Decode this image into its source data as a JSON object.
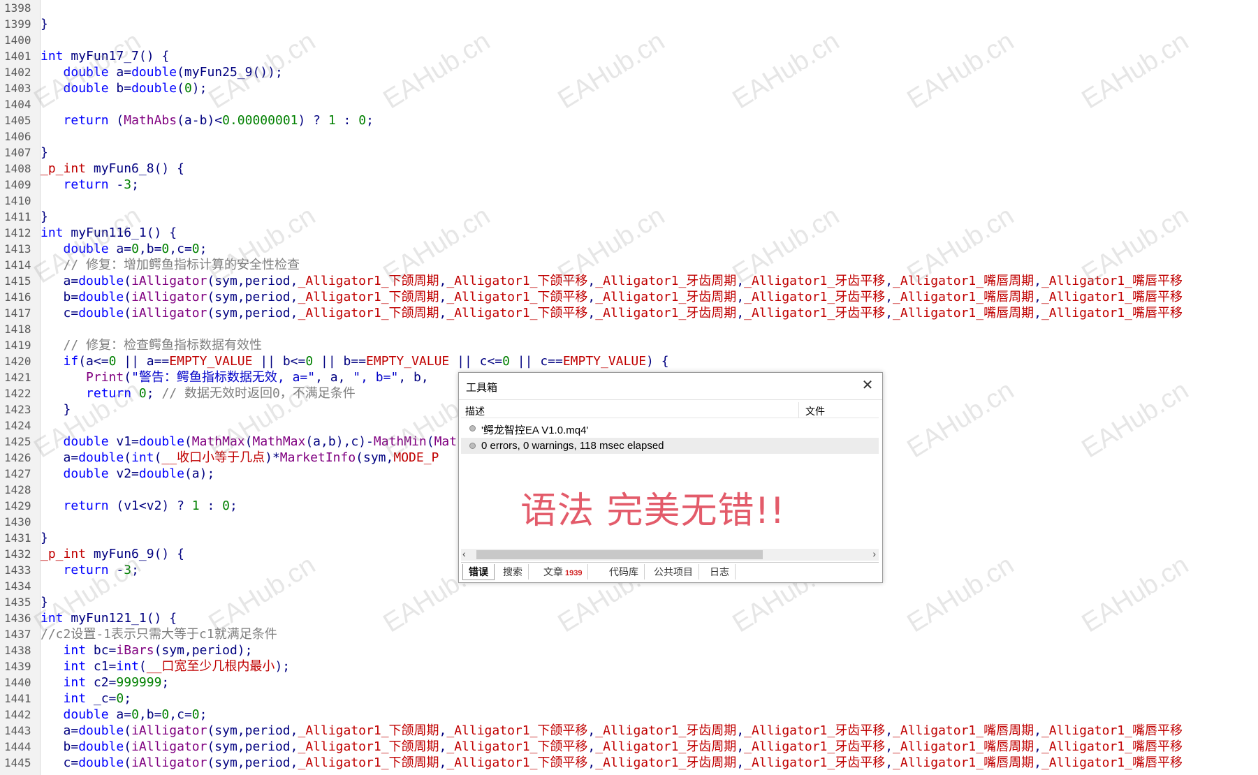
{
  "editor": {
    "lines": [
      {
        "n": "1398",
        "t": []
      },
      {
        "n": "1399",
        "t": [
          [
            "}",
            "p"
          ]
        ]
      },
      {
        "n": "1400",
        "t": []
      },
      {
        "n": "1401",
        "t": [
          [
            "int",
            "typ"
          ],
          [
            " myFun17_7() {",
            "p"
          ]
        ]
      },
      {
        "n": "1402",
        "t": [
          [
            "   ",
            "p"
          ],
          [
            "double",
            "typ"
          ],
          [
            " a=",
            "p"
          ],
          [
            "double",
            "typ"
          ],
          [
            "(myFun25_9());",
            "p"
          ]
        ]
      },
      {
        "n": "1403",
        "t": [
          [
            "   ",
            "p"
          ],
          [
            "double",
            "typ"
          ],
          [
            " b=",
            "p"
          ],
          [
            "double",
            "typ"
          ],
          [
            "(",
            "p"
          ],
          [
            "0",
            "num"
          ],
          [
            ");",
            "p"
          ]
        ]
      },
      {
        "n": "1404",
        "t": []
      },
      {
        "n": "1405",
        "t": [
          [
            "   ",
            "p"
          ],
          [
            "return",
            "kw"
          ],
          [
            " (",
            "p"
          ],
          [
            "MathAbs",
            "fn"
          ],
          [
            "(a-b)<",
            "p"
          ],
          [
            "0.00000001",
            "num"
          ],
          [
            ") ? ",
            "p"
          ],
          [
            "1",
            "num"
          ],
          [
            " : ",
            "p"
          ],
          [
            "0",
            "num"
          ],
          [
            ";",
            "p"
          ]
        ]
      },
      {
        "n": "1406",
        "t": []
      },
      {
        "n": "1407",
        "t": [
          [
            "}",
            "p"
          ]
        ]
      },
      {
        "n": "1408",
        "t": [
          [
            "_p_int",
            "mac"
          ],
          [
            " myFun6_8() {",
            "p"
          ]
        ]
      },
      {
        "n": "1409",
        "t": [
          [
            "   ",
            "p"
          ],
          [
            "return",
            "kw"
          ],
          [
            " -",
            "p"
          ],
          [
            "3",
            "num"
          ],
          [
            ";",
            "p"
          ]
        ]
      },
      {
        "n": "1410",
        "t": []
      },
      {
        "n": "1411",
        "t": [
          [
            "}",
            "p"
          ]
        ]
      },
      {
        "n": "1412",
        "t": [
          [
            "int",
            "typ"
          ],
          [
            " myFun116_1() {",
            "p"
          ]
        ]
      },
      {
        "n": "1413",
        "t": [
          [
            "   ",
            "p"
          ],
          [
            "double",
            "typ"
          ],
          [
            " a=",
            "p"
          ],
          [
            "0",
            "num"
          ],
          [
            ",b=",
            "p"
          ],
          [
            "0",
            "num"
          ],
          [
            ",c=",
            "p"
          ],
          [
            "0",
            "num"
          ],
          [
            ";",
            "p"
          ]
        ]
      },
      {
        "n": "1414",
        "t": [
          [
            "   // 修复：增加鳄鱼指标计算的安全性检查",
            "cmt"
          ]
        ]
      },
      {
        "n": "1415",
        "t": [
          [
            "   a=",
            "p"
          ],
          [
            "double",
            "typ"
          ],
          [
            "(",
            "p"
          ],
          [
            "iAlligator",
            "fn"
          ],
          [
            "(sym,period,",
            "p"
          ],
          [
            "_Alligator1_下颌周期",
            "cst"
          ],
          [
            ",",
            "p"
          ],
          [
            "_Alligator1_下颌平移",
            "cst"
          ],
          [
            ",",
            "p"
          ],
          [
            "_Alligator1_牙齿周期",
            "cst"
          ],
          [
            ",",
            "p"
          ],
          [
            "_Alligator1_牙齿平移",
            "cst"
          ],
          [
            ",",
            "p"
          ],
          [
            "_Alligator1_嘴唇周期",
            "cst"
          ],
          [
            ",",
            "p"
          ],
          [
            "_Alligator1_嘴唇平移",
            "cst"
          ]
        ]
      },
      {
        "n": "1416",
        "t": [
          [
            "   b=",
            "p"
          ],
          [
            "double",
            "typ"
          ],
          [
            "(",
            "p"
          ],
          [
            "iAlligator",
            "fn"
          ],
          [
            "(sym,period,",
            "p"
          ],
          [
            "_Alligator1_下颌周期",
            "cst"
          ],
          [
            ",",
            "p"
          ],
          [
            "_Alligator1_下颌平移",
            "cst"
          ],
          [
            ",",
            "p"
          ],
          [
            "_Alligator1_牙齿周期",
            "cst"
          ],
          [
            ",",
            "p"
          ],
          [
            "_Alligator1_牙齿平移",
            "cst"
          ],
          [
            ",",
            "p"
          ],
          [
            "_Alligator1_嘴唇周期",
            "cst"
          ],
          [
            ",",
            "p"
          ],
          [
            "_Alligator1_嘴唇平移",
            "cst"
          ]
        ]
      },
      {
        "n": "1417",
        "t": [
          [
            "   c=",
            "p"
          ],
          [
            "double",
            "typ"
          ],
          [
            "(",
            "p"
          ],
          [
            "iAlligator",
            "fn"
          ],
          [
            "(sym,period,",
            "p"
          ],
          [
            "_Alligator1_下颌周期",
            "cst"
          ],
          [
            ",",
            "p"
          ],
          [
            "_Alligator1_下颌平移",
            "cst"
          ],
          [
            ",",
            "p"
          ],
          [
            "_Alligator1_牙齿周期",
            "cst"
          ],
          [
            ",",
            "p"
          ],
          [
            "_Alligator1_牙齿平移",
            "cst"
          ],
          [
            ",",
            "p"
          ],
          [
            "_Alligator1_嘴唇周期",
            "cst"
          ],
          [
            ",",
            "p"
          ],
          [
            "_Alligator1_嘴唇平移",
            "cst"
          ]
        ]
      },
      {
        "n": "1418",
        "t": []
      },
      {
        "n": "1419",
        "t": [
          [
            "   // 修复：检查鳄鱼指标数据有效性",
            "cmt"
          ]
        ]
      },
      {
        "n": "1420",
        "t": [
          [
            "   ",
            "p"
          ],
          [
            "if",
            "kw"
          ],
          [
            "(a<=",
            "p"
          ],
          [
            "0",
            "num"
          ],
          [
            " || a==",
            "p"
          ],
          [
            "EMPTY_VALUE",
            "cst"
          ],
          [
            " || b<=",
            "p"
          ],
          [
            "0",
            "num"
          ],
          [
            " || b==",
            "p"
          ],
          [
            "EMPTY_VALUE",
            "cst"
          ],
          [
            " || c<=",
            "p"
          ],
          [
            "0",
            "num"
          ],
          [
            " || c==",
            "p"
          ],
          [
            "EMPTY_VALUE",
            "cst"
          ],
          [
            ") {",
            "p"
          ]
        ]
      },
      {
        "n": "1421",
        "t": [
          [
            "      ",
            "p"
          ],
          [
            "Print",
            "fn"
          ],
          [
            "(",
            "p"
          ],
          [
            "\"警告：鳄鱼指标数据无效, a=\"",
            "str"
          ],
          [
            ", a, ",
            "p"
          ],
          [
            "\", b=\"",
            "str"
          ],
          [
            ", b, ",
            "p"
          ]
        ]
      },
      {
        "n": "1422",
        "t": [
          [
            "      ",
            "p"
          ],
          [
            "return",
            "kw"
          ],
          [
            " ",
            "p"
          ],
          [
            "0",
            "num"
          ],
          [
            "; ",
            "p"
          ],
          [
            "// 数据无效时返回0，不满足条件",
            "cmt"
          ]
        ]
      },
      {
        "n": "1423",
        "t": [
          [
            "   }",
            "p"
          ]
        ]
      },
      {
        "n": "1424",
        "t": []
      },
      {
        "n": "1425",
        "t": [
          [
            "   ",
            "p"
          ],
          [
            "double",
            "typ"
          ],
          [
            " v1=",
            "p"
          ],
          [
            "double",
            "typ"
          ],
          [
            "(",
            "p"
          ],
          [
            "MathMax",
            "fn"
          ],
          [
            "(",
            "p"
          ],
          [
            "MathMax",
            "fn"
          ],
          [
            "(a,b),c)-",
            "p"
          ],
          [
            "MathMin",
            "fn"
          ],
          [
            "(",
            "p"
          ],
          [
            "Mat",
            "fn"
          ]
        ]
      },
      {
        "n": "1426",
        "t": [
          [
            "   a=",
            "p"
          ],
          [
            "double",
            "typ"
          ],
          [
            "(",
            "p"
          ],
          [
            "int",
            "typ"
          ],
          [
            "(",
            "p"
          ],
          [
            "__收口小等于几点",
            "cst"
          ],
          [
            ")*",
            "p"
          ],
          [
            "MarketInfo",
            "fn"
          ],
          [
            "(sym,",
            "p"
          ],
          [
            "MODE_P",
            "cst"
          ]
        ]
      },
      {
        "n": "1427",
        "t": [
          [
            "   ",
            "p"
          ],
          [
            "double",
            "typ"
          ],
          [
            " v2=",
            "p"
          ],
          [
            "double",
            "typ"
          ],
          [
            "(a);",
            "p"
          ]
        ]
      },
      {
        "n": "1428",
        "t": []
      },
      {
        "n": "1429",
        "t": [
          [
            "   ",
            "p"
          ],
          [
            "return",
            "kw"
          ],
          [
            " (v1<v2) ? ",
            "p"
          ],
          [
            "1",
            "num"
          ],
          [
            " : ",
            "p"
          ],
          [
            "0",
            "num"
          ],
          [
            ";",
            "p"
          ]
        ]
      },
      {
        "n": "1430",
        "t": []
      },
      {
        "n": "1431",
        "t": [
          [
            "}",
            "p"
          ]
        ]
      },
      {
        "n": "1432",
        "t": [
          [
            "_p_int",
            "mac"
          ],
          [
            " myFun6_9() {",
            "p"
          ]
        ]
      },
      {
        "n": "1433",
        "t": [
          [
            "   ",
            "p"
          ],
          [
            "return",
            "kw"
          ],
          [
            " -",
            "p"
          ],
          [
            "3",
            "num"
          ],
          [
            ";",
            "p"
          ]
        ]
      },
      {
        "n": "1434",
        "t": []
      },
      {
        "n": "1435",
        "t": [
          [
            "}",
            "p"
          ]
        ]
      },
      {
        "n": "1436",
        "t": [
          [
            "int",
            "typ"
          ],
          [
            " myFun121_1() {",
            "p"
          ]
        ]
      },
      {
        "n": "1437",
        "t": [
          [
            "//c2设置-1表示只需大等于c1就满足条件",
            "cmt"
          ]
        ]
      },
      {
        "n": "1438",
        "t": [
          [
            "   ",
            "p"
          ],
          [
            "int",
            "typ"
          ],
          [
            " bc=",
            "p"
          ],
          [
            "iBars",
            "fn"
          ],
          [
            "(sym,period);",
            "p"
          ]
        ]
      },
      {
        "n": "1439",
        "t": [
          [
            "   ",
            "p"
          ],
          [
            "int",
            "typ"
          ],
          [
            " c1=",
            "p"
          ],
          [
            "int",
            "typ"
          ],
          [
            "(",
            "p"
          ],
          [
            "__口宽至少几根内最小",
            "cst"
          ],
          [
            ");",
            "p"
          ]
        ]
      },
      {
        "n": "1440",
        "t": [
          [
            "   ",
            "p"
          ],
          [
            "int",
            "typ"
          ],
          [
            " c2=",
            "p"
          ],
          [
            "999999",
            "num"
          ],
          [
            ";",
            "p"
          ]
        ]
      },
      {
        "n": "1441",
        "t": [
          [
            "   ",
            "p"
          ],
          [
            "int",
            "typ"
          ],
          [
            " _c=",
            "p"
          ],
          [
            "0",
            "num"
          ],
          [
            ";",
            "p"
          ]
        ]
      },
      {
        "n": "1442",
        "t": [
          [
            "   ",
            "p"
          ],
          [
            "double",
            "typ"
          ],
          [
            " a=",
            "p"
          ],
          [
            "0",
            "num"
          ],
          [
            ",b=",
            "p"
          ],
          [
            "0",
            "num"
          ],
          [
            ",c=",
            "p"
          ],
          [
            "0",
            "num"
          ],
          [
            ";",
            "p"
          ]
        ]
      },
      {
        "n": "1443",
        "t": [
          [
            "   a=",
            "p"
          ],
          [
            "double",
            "typ"
          ],
          [
            "(",
            "p"
          ],
          [
            "iAlligator",
            "fn"
          ],
          [
            "(sym,period,",
            "p"
          ],
          [
            "_Alligator1_下颌周期",
            "cst"
          ],
          [
            ",",
            "p"
          ],
          [
            "_Alligator1_下颌平移",
            "cst"
          ],
          [
            ",",
            "p"
          ],
          [
            "_Alligator1_牙齿周期",
            "cst"
          ],
          [
            ",",
            "p"
          ],
          [
            "_Alligator1_牙齿平移",
            "cst"
          ],
          [
            ",",
            "p"
          ],
          [
            "_Alligator1_嘴唇周期",
            "cst"
          ],
          [
            ",",
            "p"
          ],
          [
            "_Alligator1_嘴唇平移",
            "cst"
          ]
        ]
      },
      {
        "n": "1444",
        "t": [
          [
            "   b=",
            "p"
          ],
          [
            "double",
            "typ"
          ],
          [
            "(",
            "p"
          ],
          [
            "iAlligator",
            "fn"
          ],
          [
            "(sym,period,",
            "p"
          ],
          [
            "_Alligator1_下颌周期",
            "cst"
          ],
          [
            ",",
            "p"
          ],
          [
            "_Alligator1_下颌平移",
            "cst"
          ],
          [
            ",",
            "p"
          ],
          [
            "_Alligator1_牙齿周期",
            "cst"
          ],
          [
            ",",
            "p"
          ],
          [
            "_Alligator1_牙齿平移",
            "cst"
          ],
          [
            ",",
            "p"
          ],
          [
            "_Alligator1_嘴唇周期",
            "cst"
          ],
          [
            ",",
            "p"
          ],
          [
            "_Alligator1_嘴唇平移",
            "cst"
          ]
        ]
      },
      {
        "n": "1445",
        "t": [
          [
            "   c=",
            "p"
          ],
          [
            "double",
            "typ"
          ],
          [
            "(",
            "p"
          ],
          [
            "iAlligator",
            "fn"
          ],
          [
            "(sym,period,",
            "p"
          ],
          [
            "_Alligator1_下颌周期",
            "cst"
          ],
          [
            ",",
            "p"
          ],
          [
            "_Alligator1_下颌平移",
            "cst"
          ],
          [
            ",",
            "p"
          ],
          [
            "_Alligator1_牙齿周期",
            "cst"
          ],
          [
            ",",
            "p"
          ],
          [
            "_Alligator1_牙齿平移",
            "cst"
          ],
          [
            ",",
            "p"
          ],
          [
            "_Alligator1_嘴唇周期",
            "cst"
          ],
          [
            ",",
            "p"
          ],
          [
            "_Alligator1_嘴唇平移",
            "cst"
          ]
        ]
      }
    ]
  },
  "watermark": {
    "text": "EAHub.cn"
  },
  "toolbox": {
    "title": "工具箱",
    "close_glyph": "✕",
    "columns": {
      "description": "描述",
      "file": "文件"
    },
    "rows": [
      {
        "text": "'鳄龙智控EA V1.0.mq4'"
      },
      {
        "text": "0 errors, 0 warnings, 118 msec elapsed"
      }
    ],
    "big_message": "语法 完美无错!!",
    "scroll": {
      "left": "‹",
      "right": "›"
    },
    "tabs": [
      {
        "label": "错误",
        "active": true
      },
      {
        "label": "搜索"
      },
      {
        "label": "文章",
        "count": "1939"
      },
      {
        "label": "代码库"
      },
      {
        "label": "公共项目"
      },
      {
        "label": "日志"
      }
    ]
  }
}
